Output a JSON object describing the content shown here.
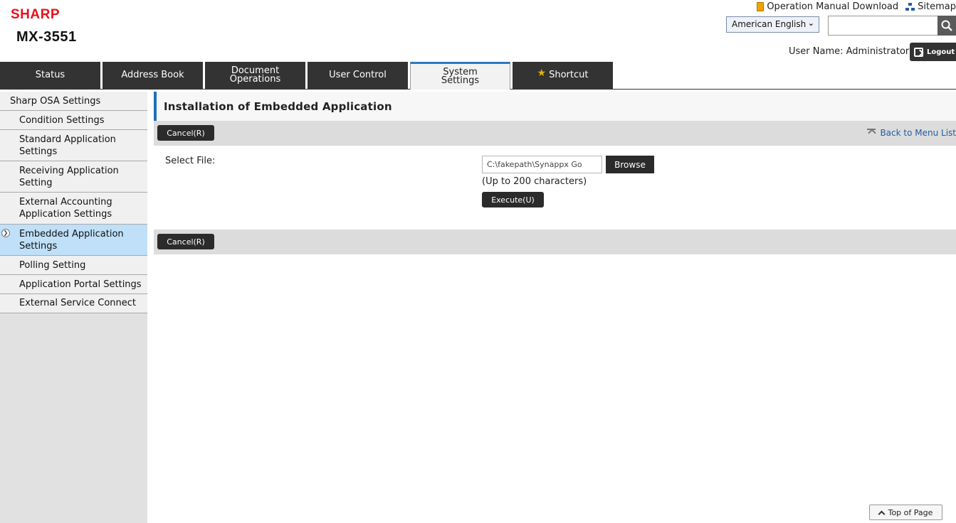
{
  "header": {
    "brand": "SHARP",
    "model": "MX-3551",
    "manual_link": "Operation Manual Download",
    "sitemap_link": "Sitemap",
    "language": "American English",
    "search_value": "",
    "user_name": "User Name: Administrator",
    "logout": "Logout"
  },
  "tabs": [
    {
      "label": "Status"
    },
    {
      "label": "Address Book"
    },
    {
      "label": "Document\nOperations"
    },
    {
      "label": "User Control"
    },
    {
      "label": "System\nSettings",
      "active": true
    },
    {
      "label": "Shortcut"
    }
  ],
  "sidebar": {
    "items": [
      {
        "label": "Sharp OSA Settings"
      },
      {
        "label": "Condition Settings"
      },
      {
        "label": "Standard Application Settings"
      },
      {
        "label": "Receiving Application Setting"
      },
      {
        "label": "External Accounting Application Settings"
      },
      {
        "label": "Embedded Application Settings",
        "active": true
      },
      {
        "label": "Polling Setting"
      },
      {
        "label": "Application Portal Settings"
      },
      {
        "label": "External Service Connect"
      }
    ]
  },
  "main": {
    "title": "Installation of Embedded Application",
    "cancel_label": "Cancel(R)",
    "back_link": "Back to Menu List",
    "select_file_label": "Select File:",
    "file_value": "C:\\fakepath\\Synappx Go",
    "browse_label": "Browse",
    "hint": "(Up to 200 characters)",
    "execute_label": "Execute(U)",
    "top_of_page": "Top of Page"
  },
  "colors": {
    "brand": "#e8101e",
    "tab_bg": "#333333",
    "active_accent": "#1f6fb8",
    "sidebar_active": "#bfe0f8"
  }
}
